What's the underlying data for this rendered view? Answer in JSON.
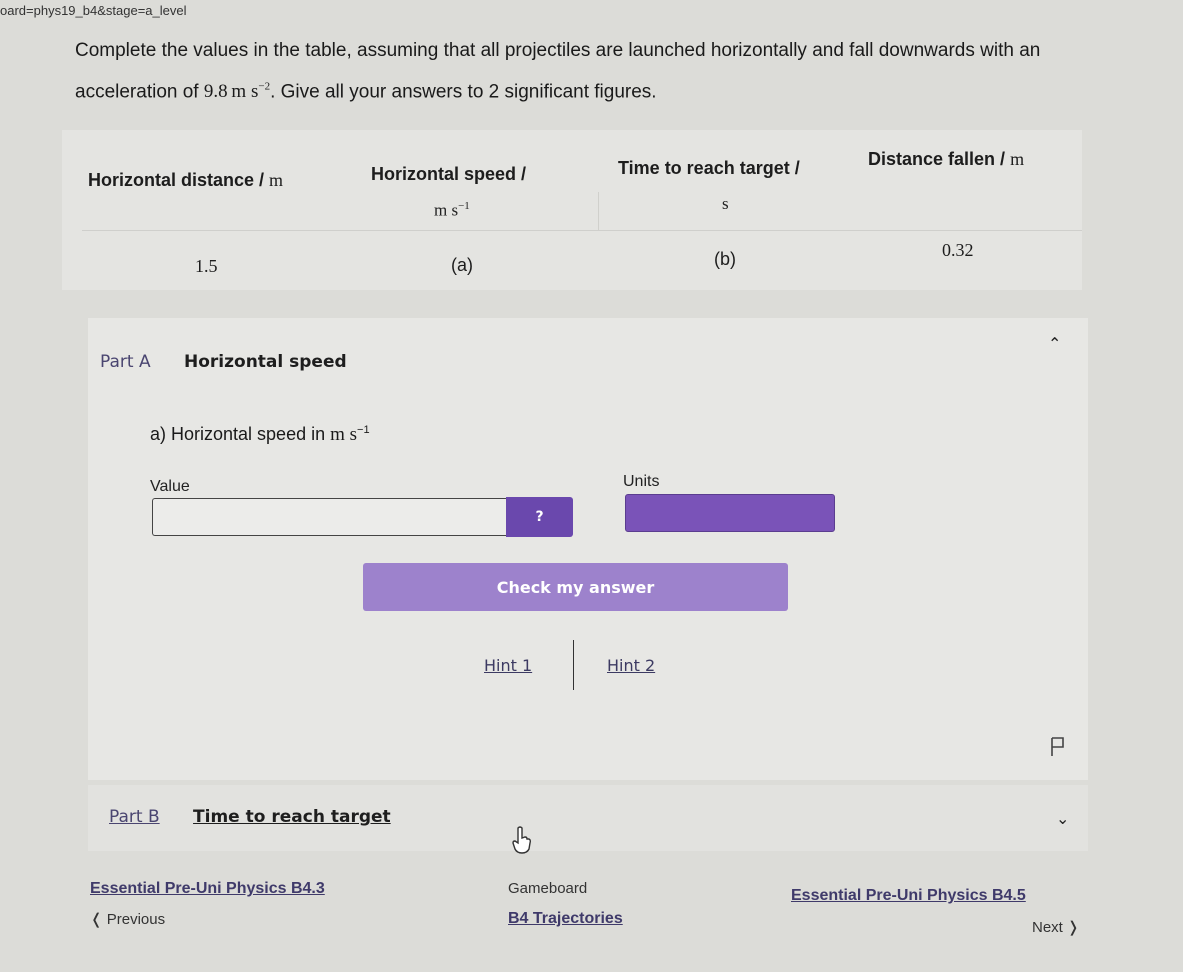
{
  "browser": {
    "url_fragment": "oard=phys19_b4&stage=a_level"
  },
  "intro": {
    "text_before": "Complete the values in the table, assuming that all projectiles are launched horizontally and fall downwards with an acceleration of ",
    "accel_value": "9.8",
    "accel_unit": "m s",
    "accel_exp": "−2",
    "text_after": ". Give all your answers to 2 significant figures."
  },
  "table": {
    "headers": [
      {
        "label": "Horizontal distance / ",
        "unit": "m",
        "unit_exp": ""
      },
      {
        "label": "Horizontal speed / ",
        "unit": "m s",
        "unit_exp": "−1"
      },
      {
        "label": "Time to reach target / ",
        "unit": "s",
        "unit_exp": ""
      },
      {
        "label": "Distance fallen / ",
        "unit": "m",
        "unit_exp": ""
      }
    ],
    "rows": [
      [
        "1.5",
        "(a)",
        "(b)",
        "0.32"
      ]
    ]
  },
  "part_a": {
    "label": "Part A",
    "title": "Horizontal speed",
    "question": "a) Horizontal speed in ",
    "question_unit": "m s",
    "question_exp": "−1",
    "value_label": "Value",
    "value_input": "",
    "help_button": "?",
    "units_label": "Units",
    "units_selected": "",
    "check_button": "Check my answer",
    "hints": [
      "Hint 1",
      "Hint 2"
    ]
  },
  "part_b": {
    "label": "Part B",
    "title": "Time to reach target"
  },
  "footer": {
    "prev_title": "Essential Pre-Uni Physics B4.3",
    "prev_label": "Previous",
    "gameboard_label": "Gameboard",
    "gameboard_name": "B4 Trajectories",
    "next_title": "Essential Pre-Uni Physics B4.5",
    "next_label": "Next"
  },
  "colors": {
    "accent": "#6a48ad",
    "check_button": "#9d82cc",
    "link": "#3f3a6a"
  }
}
